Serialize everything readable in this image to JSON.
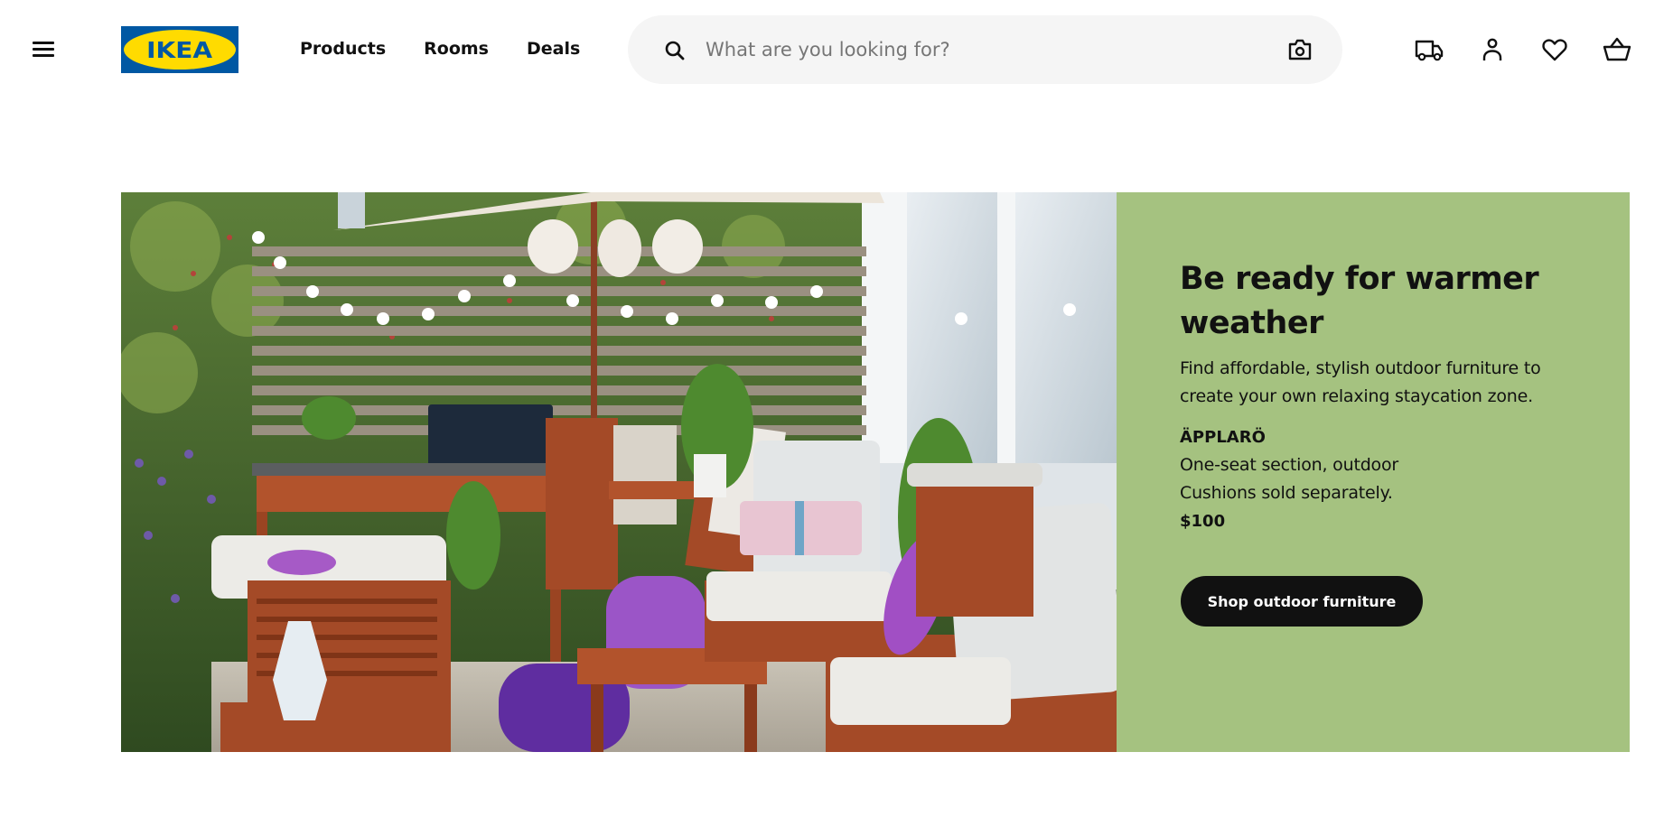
{
  "header": {
    "menu_icon": "hamburger-menu-icon",
    "logo_text": "IKEA",
    "brand_colors": {
      "blue": "#0058a3",
      "yellow": "#ffdb00"
    },
    "nav": [
      {
        "label": "Products"
      },
      {
        "label": "Rooms"
      },
      {
        "label": "Deals"
      }
    ],
    "search": {
      "placeholder": "What are you looking for?",
      "value": "",
      "search_icon": "search-icon",
      "visual_search_icon": "camera-icon"
    },
    "actions": [
      {
        "name": "delivery",
        "icon": "truck-icon"
      },
      {
        "name": "account",
        "icon": "person-icon"
      },
      {
        "name": "favourites",
        "icon": "heart-icon"
      },
      {
        "name": "cart",
        "icon": "basket-icon"
      }
    ]
  },
  "hero": {
    "image_alt": "Outdoor patio with ÄPPLARÖ wooden furniture, white cushions, purple poufs, parasol and string lights",
    "panel_color": "#a5c280",
    "title": "Be ready for warmer weather",
    "description": "Find affordable, stylish outdoor furniture to create your own relaxing staycation zone.",
    "product": {
      "name": "ÄPPLARÖ",
      "type": "One-seat section, outdoor",
      "note": "Cushions sold separately.",
      "price": "$100"
    },
    "cta_label": "Shop outdoor furniture"
  }
}
